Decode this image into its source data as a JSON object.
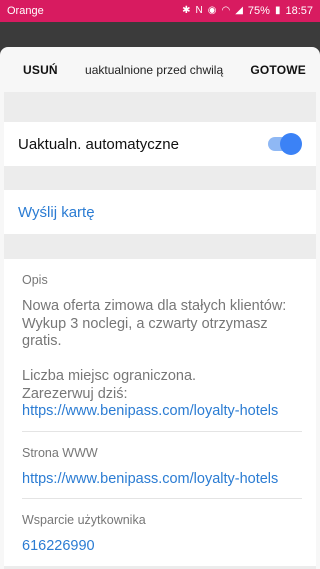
{
  "status_bar": {
    "carrier": "Orange",
    "battery": "75%",
    "time": "18:57",
    "icons": [
      "bluetooth-icon",
      "nfc-icon",
      "eye-icon",
      "wifi-icon",
      "signal-icon",
      "battery-icon"
    ]
  },
  "header": {
    "left_button": "USUŃ",
    "title": "uaktualnione przed chwilą",
    "right_button": "GOTOWE"
  },
  "auto_update": {
    "label": "Uaktualn. automatyczne",
    "enabled": true
  },
  "send_card": {
    "label": "Wyślij kartę"
  },
  "details": {
    "description_label": "Opis",
    "description_text_1": "Nowa oferta zimowa dla stałych klientów: Wykup 3 noclegi, a czwarty otrzymasz gratis.",
    "description_text_2": "Liczba miejsc ograniczona.",
    "description_text_3": "Zarezerwuj dziś:",
    "description_link": "https://www.benipass.com/loyalty-hotels",
    "website_label": "Strona WWW",
    "website_link": "https://www.benipass.com/loyalty-hotels",
    "support_label": "Wsparcie użytkownika",
    "support_phone": "616226990"
  },
  "colors": {
    "status_bar": "#d81b60",
    "accent": "#2b7cd3",
    "toggle_on": "#3b82f6"
  }
}
